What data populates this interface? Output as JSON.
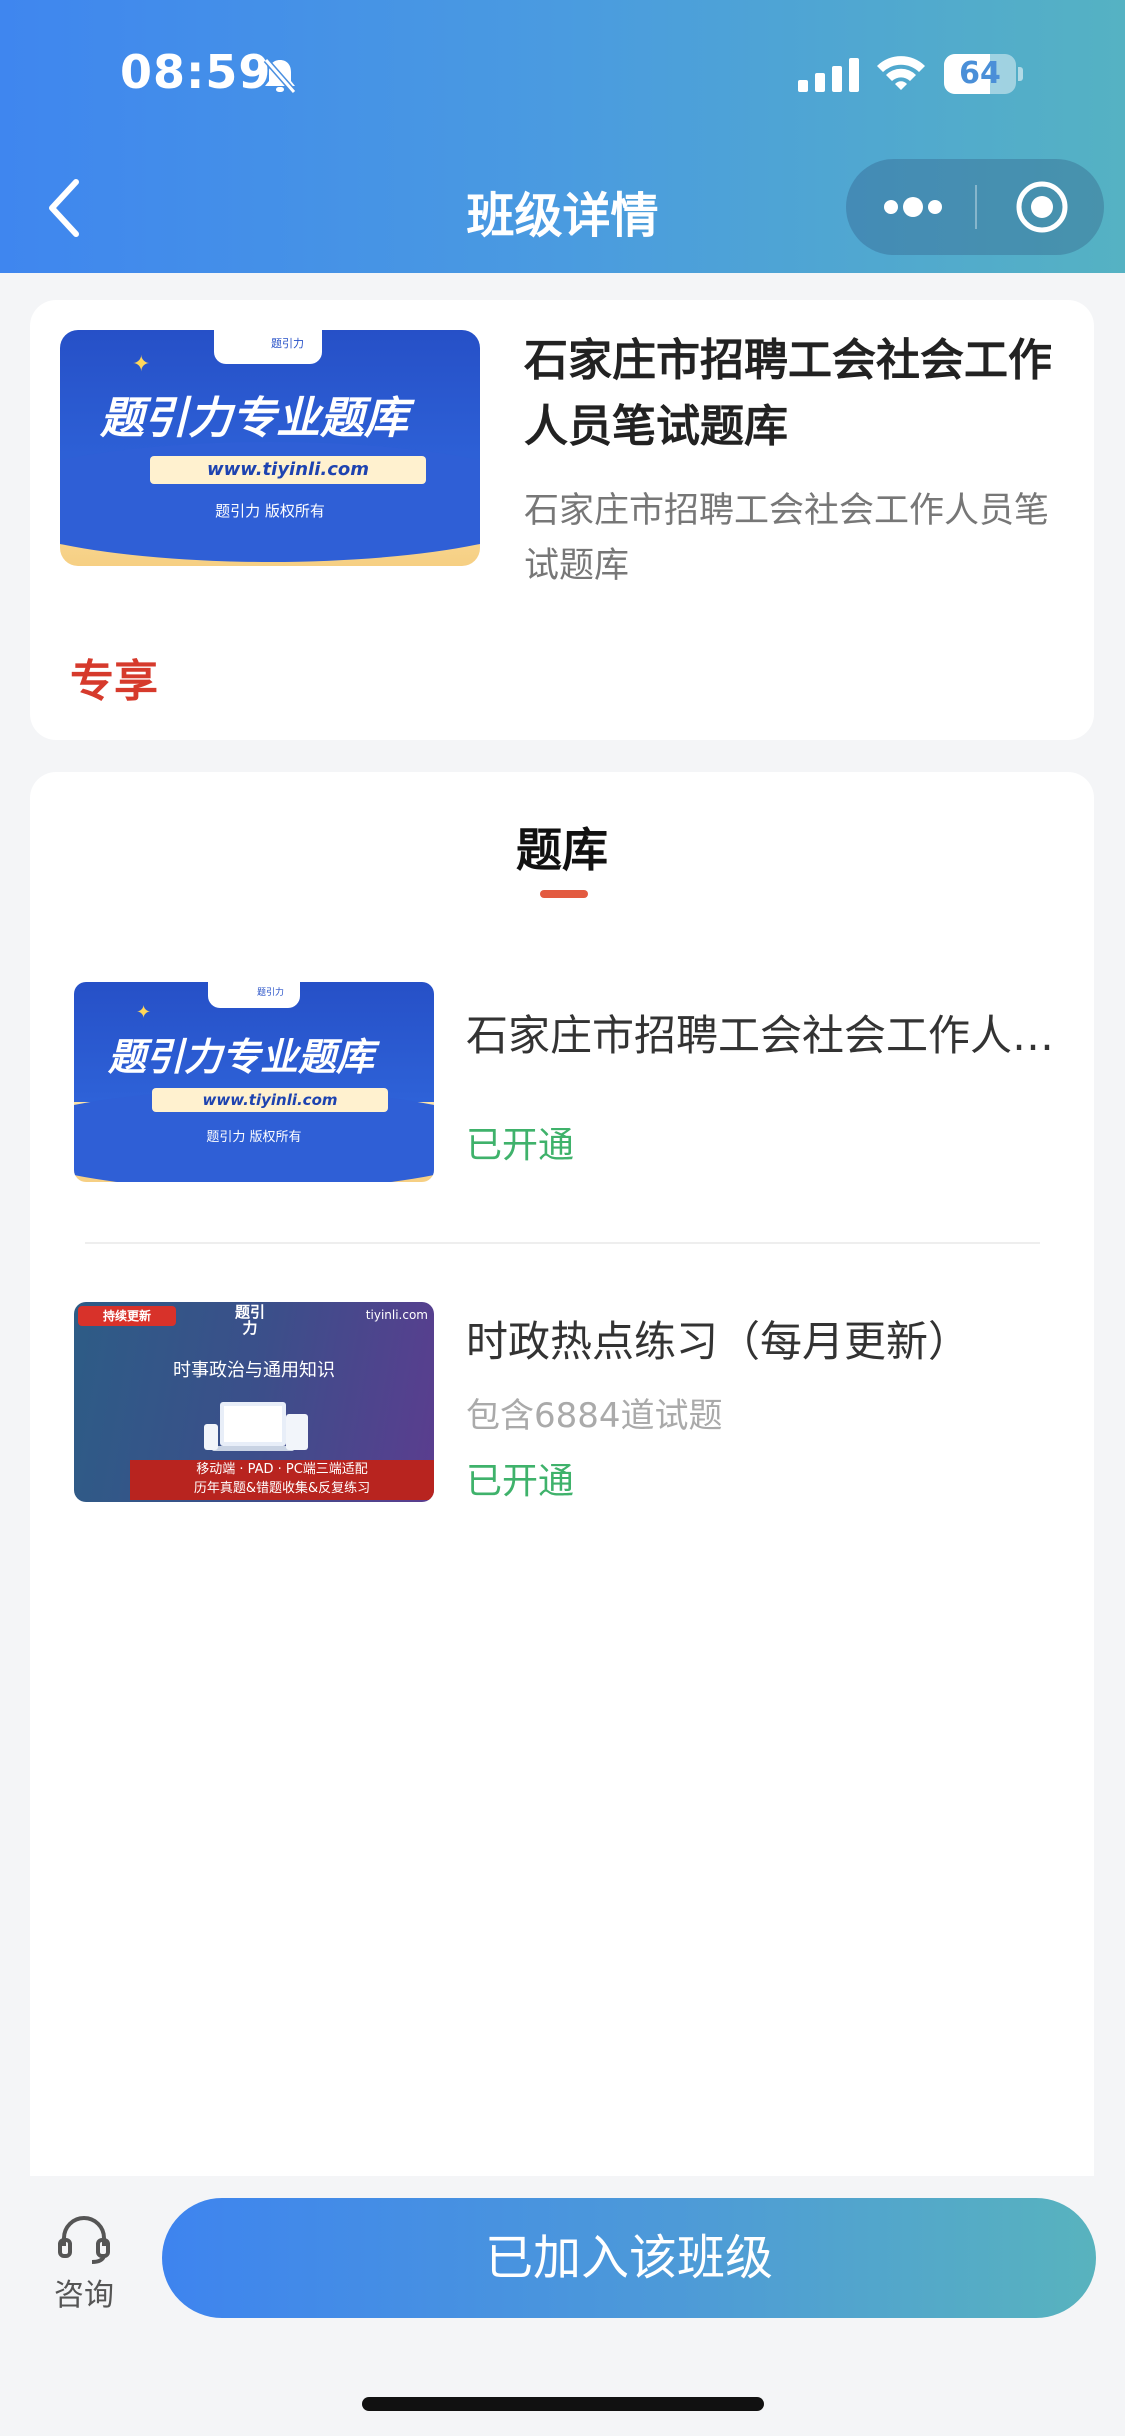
{
  "status_bar": {
    "time": "08:59",
    "battery": "64",
    "battery_level": 0.64
  },
  "nav": {
    "title": "班级详情"
  },
  "class_card": {
    "cover": {
      "tab_text": "题引力",
      "main_text": "题引力专业题库",
      "url": "www.tiyinli.com",
      "copyright": "题引力 版权所有"
    },
    "title": "石家庄市招聘工会社会工作人员笔试题库",
    "description": "石家庄市招聘工会社会工作人员笔试题库",
    "tag": "专享"
  },
  "question_bank": {
    "section_title": "题库",
    "items": [
      {
        "title": "石家庄市招聘工会社会工作人员笔试题库",
        "subtitle": "",
        "status": "已开通",
        "cover": {
          "tab_text": "题引力",
          "main_text": "题引力专业题库",
          "url": "www.tiyinli.com",
          "copyright": "题引力 版权所有"
        }
      },
      {
        "title": "时政热点练习（每月更新）",
        "subtitle": "包含6884道试题",
        "status": "已开通",
        "cover": {
          "badge": "持续更新",
          "logo": "题引力",
          "site": "tiyinli.com",
          "headline": "时事政治与通用知识",
          "banner_line1": "移动端 · PAD · PC端三端适配",
          "banner_line2": "历年真题&错题收集&反复练习"
        }
      }
    ]
  },
  "bottom_bar": {
    "consult_label": "咨询",
    "join_button": "已加入该班级"
  },
  "colors": {
    "header_gradient_start": "#3f86ef",
    "header_gradient_end": "#55b2c3",
    "status_green": "#3fb26b",
    "tag_red": "#d63a2c",
    "underline": "#e35b41"
  },
  "icons": [
    "mute-icon",
    "signal-icon",
    "wifi-icon",
    "battery-icon",
    "back-icon",
    "more-icon",
    "target-icon",
    "headset-icon"
  ]
}
